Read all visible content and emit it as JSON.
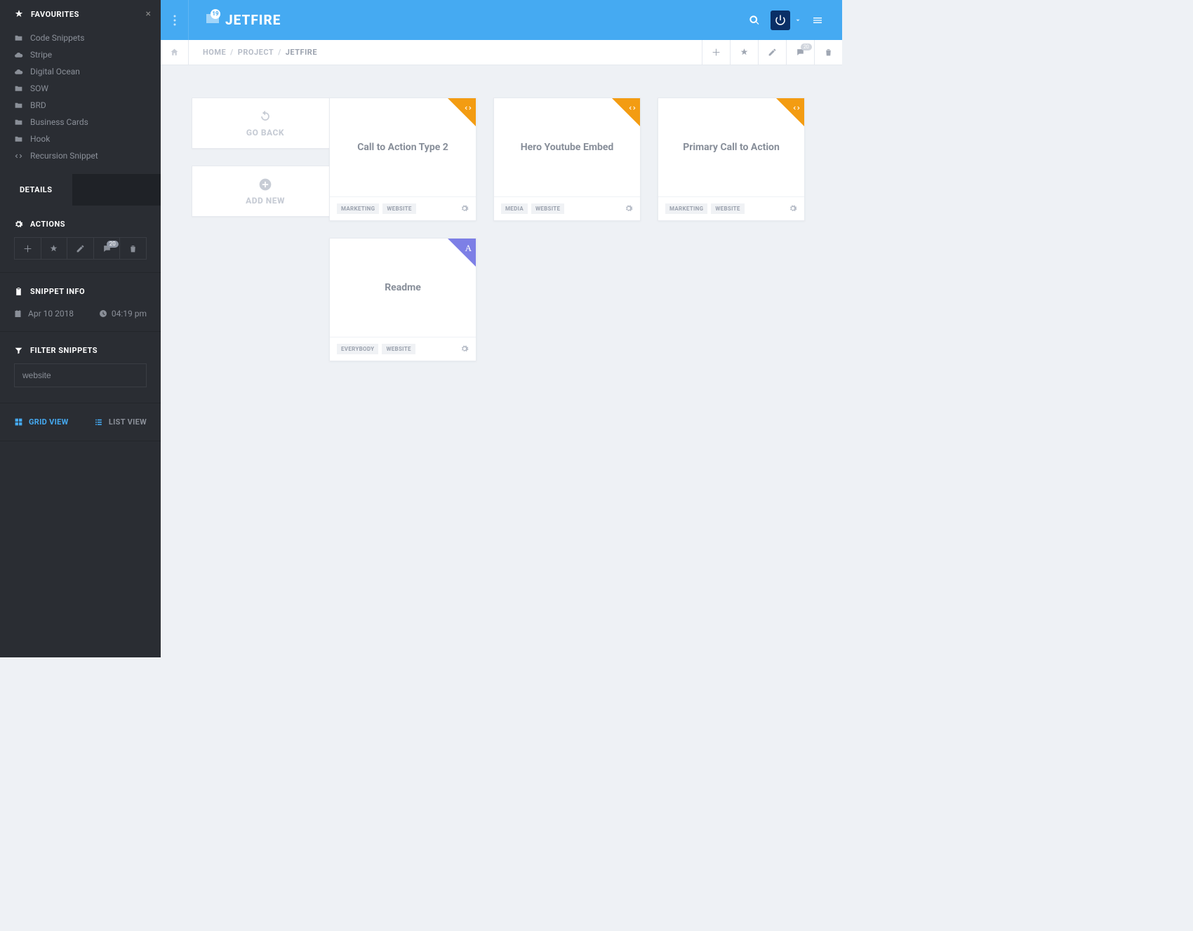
{
  "sidebar": {
    "favourites_title": "FAVOURITES",
    "favourites": [
      {
        "icon": "folder",
        "label": "Code Snippets"
      },
      {
        "icon": "cloud",
        "label": "Stripe"
      },
      {
        "icon": "cloud",
        "label": "Digital Ocean"
      },
      {
        "icon": "folder",
        "label": "SOW"
      },
      {
        "icon": "folder",
        "label": "BRD"
      },
      {
        "icon": "folder",
        "label": "Business Cards"
      },
      {
        "icon": "folder",
        "label": "Hook"
      },
      {
        "icon": "code",
        "label": "Recursion Snippet"
      }
    ],
    "tab_details": "DETAILS",
    "actions_title": "ACTIONS",
    "actions_badge": "20",
    "snippet_info_title": "SNIPPET INFO",
    "snippet_date": "Apr 10 2018",
    "snippet_time": "04:19 pm",
    "filter_title": "FILTER SNIPPETS",
    "filter_value": "website",
    "grid_view": "GRID VIEW",
    "list_view": "LIST VIEW"
  },
  "topbar": {
    "brand": "JETFIRE",
    "folder_count": "19"
  },
  "breadcrumb": {
    "home": "HOME",
    "project": "PROJECT",
    "current": "JETFIRE"
  },
  "util": {
    "go_back": "GO BACK",
    "add_new": "ADD NEW"
  },
  "cards": [
    {
      "title": "Call to Action Type 2",
      "corner": "orange",
      "corner_icon": "code",
      "tags": [
        "MARKETING",
        "WEBSITE"
      ]
    },
    {
      "title": "Hero Youtube Embed",
      "corner": "orange",
      "corner_icon": "code",
      "tags": [
        "MEDIA",
        "WEBSITE"
      ]
    },
    {
      "title": "Primary Call to Action",
      "corner": "orange",
      "corner_icon": "code",
      "tags": [
        "MARKETING",
        "WEBSITE"
      ]
    },
    {
      "title": "Readme",
      "corner": "purple",
      "corner_icon": "A",
      "tags": [
        "EVERYBODY",
        "WEBSITE"
      ]
    }
  ],
  "subbar_badge": "20"
}
